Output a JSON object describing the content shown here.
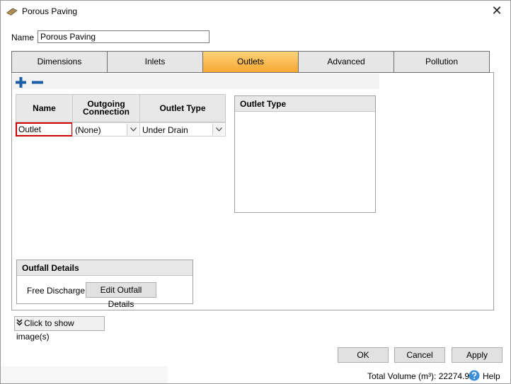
{
  "window": {
    "title": "Porous Paving",
    "close_glyph": "✕"
  },
  "name_field": {
    "label": "Name",
    "value": "Porous Paving"
  },
  "tabs": [
    {
      "label": "Dimensions",
      "active": false
    },
    {
      "label": "Inlets",
      "active": false
    },
    {
      "label": "Outlets",
      "active": true
    },
    {
      "label": "Advanced",
      "active": false
    },
    {
      "label": "Pollution",
      "active": false
    }
  ],
  "toolbar": {
    "add_icon": "plus-icon",
    "remove_icon": "minus-icon",
    "accent": "#1f5fa8"
  },
  "outlets_grid": {
    "headers": {
      "name": "Name",
      "outgoing_line1": "Outgoing",
      "outgoing_line2": "Connection",
      "type": "Outlet Type"
    },
    "rows": [
      {
        "name": "Outlet",
        "outgoing": "(None)",
        "type": "Under Drain"
      }
    ]
  },
  "outlet_type_panel": {
    "title": "Outlet Type"
  },
  "outfall": {
    "title": "Outfall Details",
    "discharge_label": "Free Discharge",
    "edit_button": "Edit Outfall Details"
  },
  "show_images": {
    "label": "Click to show image(s)",
    "icon": "double-chevron-down-icon"
  },
  "buttons": {
    "ok": "OK",
    "cancel": "Cancel",
    "apply": "Apply"
  },
  "status": {
    "total_volume": "Total Volume (m³): 22274.924",
    "help": "Help",
    "help_icon": "help-icon"
  },
  "colors": {
    "active_tab_top": "#fcd37a",
    "active_tab_bottom": "#f6a72f",
    "invalid_border": "#d00000"
  }
}
